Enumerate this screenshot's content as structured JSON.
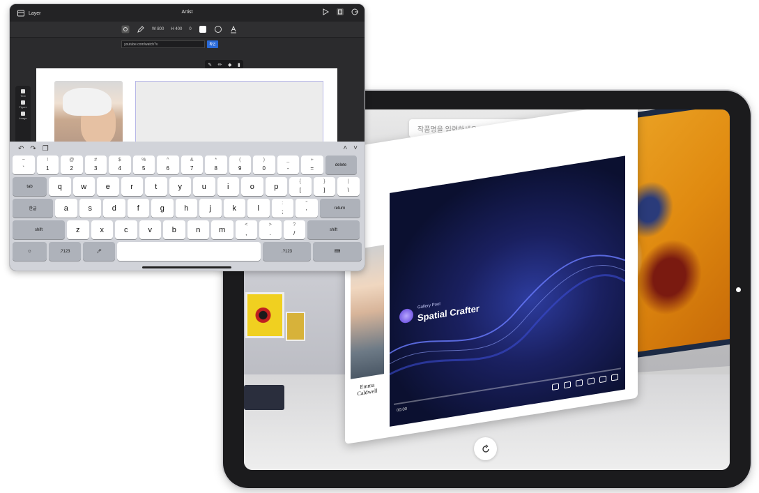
{
  "gallery": {
    "search_placeholder": "작품명을 입력하세요",
    "video": {
      "brand_small": "Gallery Pool",
      "brand": "Spatial Crafter",
      "time": "00:00"
    },
    "caption": "Emma Caldwell"
  },
  "editor": {
    "layer_label": "Layer",
    "title": "Artist",
    "toolbar": {
      "width_val": "W 800",
      "height_val": "H 400",
      "rotate_val": "0"
    },
    "url_value": "youtube.com/watch?v",
    "url_button": "확인",
    "side_tools": [
      "Text",
      "Figure",
      "Image"
    ]
  },
  "keyboard": {
    "row1": [
      {
        "top": "~",
        "bot": "`"
      },
      {
        "top": "!",
        "bot": "1"
      },
      {
        "top": "@",
        "bot": "2"
      },
      {
        "top": "#",
        "bot": "3"
      },
      {
        "top": "$",
        "bot": "4"
      },
      {
        "top": "%",
        "bot": "5"
      },
      {
        "top": "^",
        "bot": "6"
      },
      {
        "top": "&",
        "bot": "7"
      },
      {
        "top": "*",
        "bot": "8"
      },
      {
        "top": "(",
        "bot": "9"
      },
      {
        "top": ")",
        "bot": "0"
      },
      {
        "top": "_",
        "bot": "-"
      },
      {
        "top": "+",
        "bot": "="
      }
    ],
    "delete": "delete",
    "tab": "tab",
    "row2": [
      "q",
      "w",
      "e",
      "r",
      "t",
      "y",
      "u",
      "i",
      "o",
      "p"
    ],
    "row2_extra": [
      {
        "top": "{",
        "bot": "["
      },
      {
        "top": "}",
        "bot": "]"
      },
      {
        "top": "|",
        "bot": "\\"
      }
    ],
    "lang": "한글",
    "row3": [
      "a",
      "s",
      "d",
      "f",
      "g",
      "h",
      "j",
      "k",
      "l"
    ],
    "row3_extra": [
      {
        "top": ":",
        "bot": ";"
      },
      {
        "top": "\"",
        "bot": "'"
      }
    ],
    "return": "return",
    "shift_left": "shift",
    "row4": [
      "z",
      "x",
      "c",
      "v",
      "b",
      "n",
      "m"
    ],
    "row4_extra": [
      {
        "top": "<",
        "bot": ","
      },
      {
        "top": ">",
        "bot": "."
      },
      {
        "top": "?",
        "bot": "/"
      }
    ],
    "shift_right": "shift",
    "num_left": ".?123",
    "num_right": ".?123"
  }
}
